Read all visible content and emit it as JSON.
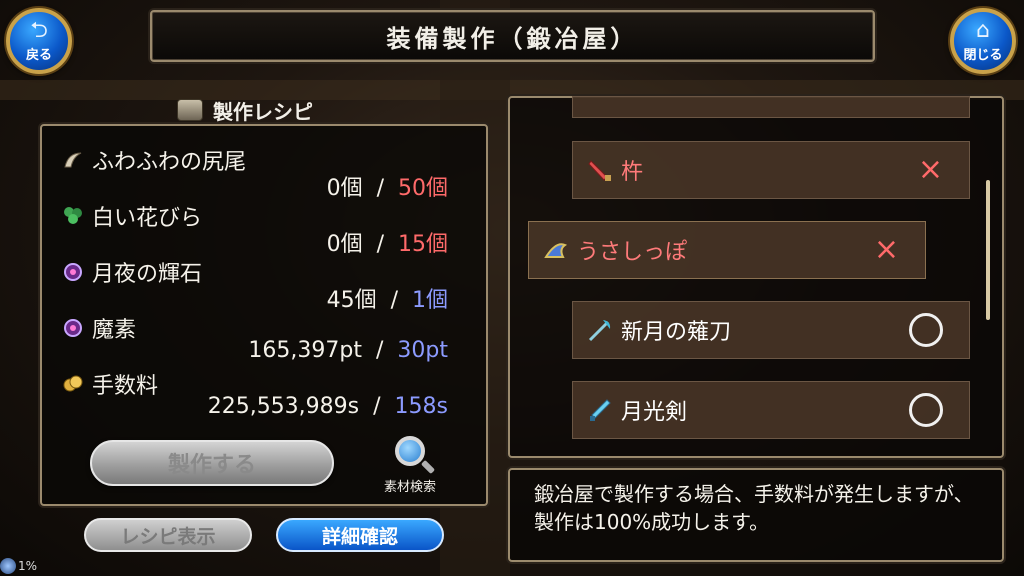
{
  "header": {
    "title": "装備製作（鍛冶屋）",
    "back_label": "戻る",
    "close_label": "閉じる"
  },
  "recipe_panel": {
    "title": "製作レシピ",
    "materials": [
      {
        "name": "ふわふわの尻尾",
        "icon": "tail-icon",
        "have": "0個",
        "separator": "/",
        "need": "50個",
        "need_color": "#ff6a6a"
      },
      {
        "name": "白い花びら",
        "icon": "leaf-icon",
        "have": "0個",
        "separator": "/",
        "need": "15個",
        "need_color": "#ff6a6a"
      },
      {
        "name": "月夜の輝石",
        "icon": "orb-icon",
        "have": "45個",
        "separator": "/",
        "need": "1個",
        "need_color": "#8c9bff"
      },
      {
        "name": "魔素",
        "icon": "orb-icon",
        "have": "165,397pt",
        "separator": "/",
        "need": "30pt",
        "need_color": "#8c9bff"
      },
      {
        "name": "手数料",
        "icon": "coins-icon",
        "have": "225,553,989s",
        "separator": "/",
        "need": "158s",
        "need_color": "#8c9bff"
      }
    ],
    "craft_button": "製作する",
    "search_label": "素材検索",
    "recipe_view_button": "レシピ表示",
    "detail_button": "詳細確認"
  },
  "progress_text": "1%",
  "recipe_list": [
    {
      "name": "杵",
      "icon": "weapon-icon",
      "status": "×",
      "name_color": "#ff7a7a"
    },
    {
      "name": "うさしっぽ",
      "icon": "hat-icon",
      "status": "×",
      "name_color": "#ff7a7a",
      "selected": true
    },
    {
      "name": "新月の薙刀",
      "icon": "glaive-icon",
      "status": "○",
      "name_color": "#f5f2ea"
    },
    {
      "name": "月光剣",
      "icon": "sword-icon",
      "status": "○",
      "name_color": "#f5f2ea"
    }
  ],
  "description": "鍛冶屋で製作する場合、手数料が発生しますが、製作は100%成功します。"
}
